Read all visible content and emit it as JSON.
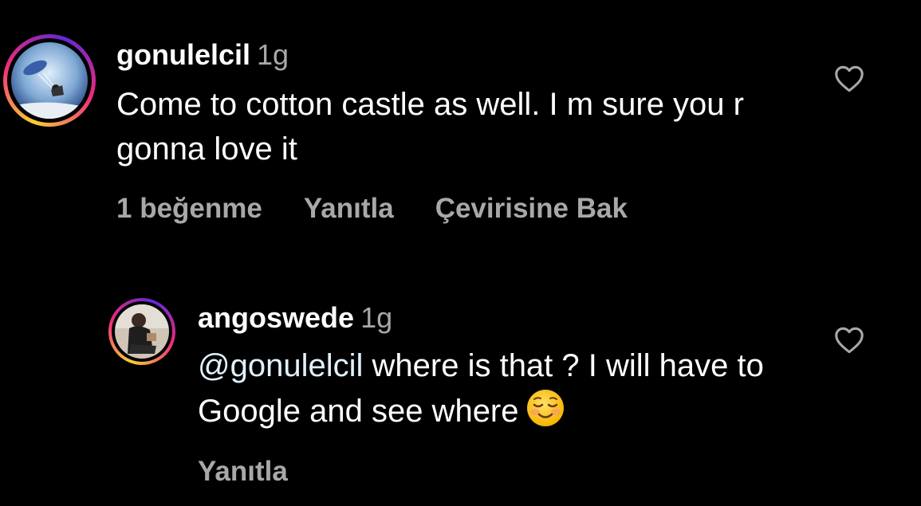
{
  "comments": [
    {
      "username": "gonulelcil",
      "time": "1g",
      "text": "Come to cotton castle as well. I m sure you r gonna love it",
      "likes": "1 beğenme",
      "reply": "Yanıtla",
      "translate": "Çevirisine Bak"
    },
    {
      "username": "angoswede",
      "time": "1g",
      "mention": "@gonulelcil",
      "text": "where is that ? I will have to Google and see where",
      "emoji": "smiling-face-icon",
      "reply": "Yanıtla"
    }
  ],
  "colors": {
    "background": "#000000",
    "secondary_text": "#a8a8a8",
    "mention": "#e0f1ff"
  }
}
